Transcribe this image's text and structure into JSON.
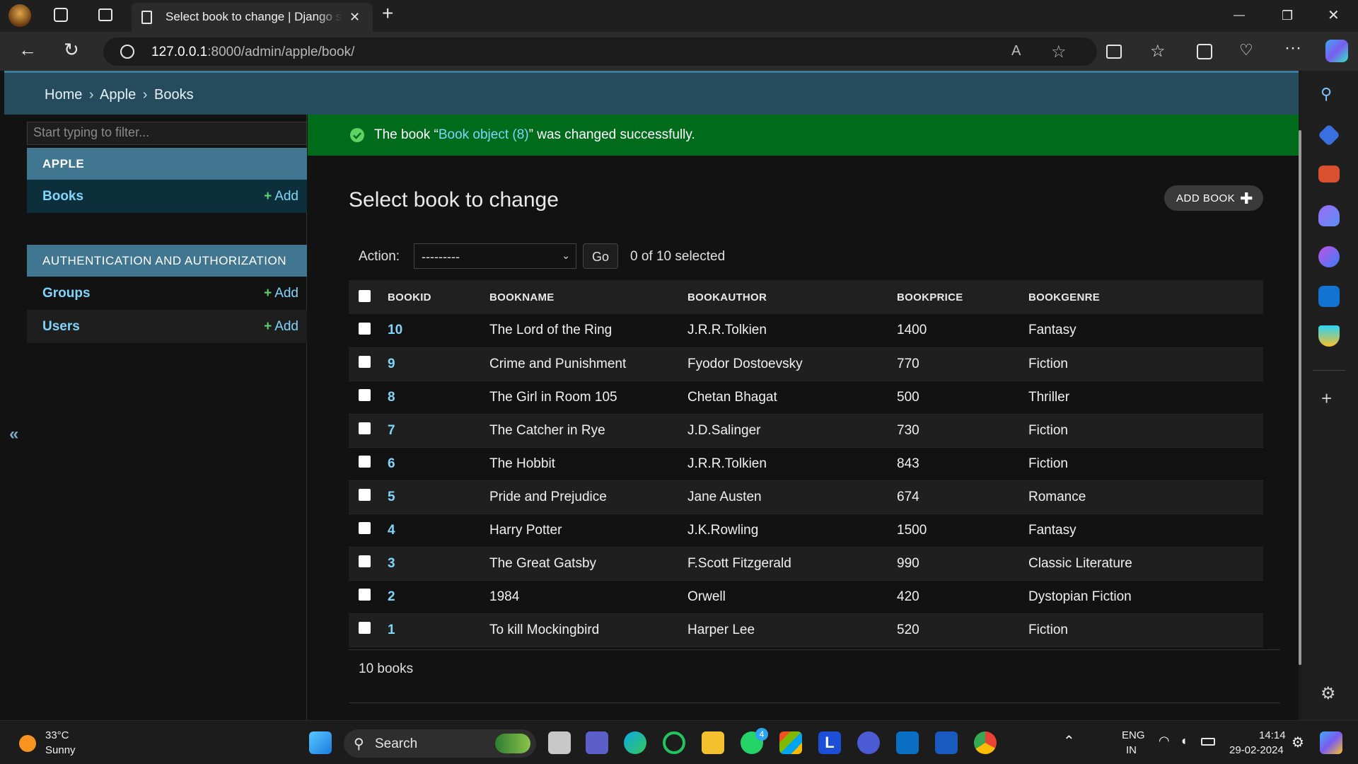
{
  "browser": {
    "tab_title": "Select book to change | Django site admin",
    "url_host": "127.0.0.1",
    "url_path": ":8000/admin/apple/book/",
    "minimize": "—",
    "restore": "❐",
    "close": "✕",
    "new_tab": "+",
    "tab_close": "✕"
  },
  "breadcrumbs": {
    "home": "Home",
    "app": "Apple",
    "current": "Books",
    "sep": "›"
  },
  "sidebar": {
    "filter_placeholder": "Start typing to filter...",
    "apps": [
      {
        "title": "APPLE",
        "models": [
          {
            "name": "Books",
            "add": "Add"
          }
        ]
      },
      {
        "title": "AUTHENTICATION AND AUTHORIZATION",
        "models": [
          {
            "name": "Groups",
            "add": "Add"
          },
          {
            "name": "Users",
            "add": "Add"
          }
        ]
      }
    ],
    "collapse": "«"
  },
  "message": {
    "prefix": "The book “",
    "link": "Book object (8)",
    "suffix": "” was changed successfully."
  },
  "page": {
    "title": "Select book to change",
    "add_button": "ADD BOOK",
    "add_plus": "✚",
    "action_label": "Action:",
    "action_value": "---------",
    "go": "Go",
    "selected": "0 of 10 selected",
    "count": "10 books"
  },
  "table": {
    "columns": [
      "BOOKID",
      "BOOKNAME",
      "BOOKAUTHOR",
      "BOOKPRICE",
      "BOOKGENRE"
    ],
    "rows": [
      [
        "10",
        "The Lord of the Ring",
        "J.R.R.Tolkien",
        "1400",
        "Fantasy"
      ],
      [
        "9",
        "Crime and Punishment",
        "Fyodor Dostoevsky",
        "770",
        "Fiction"
      ],
      [
        "8",
        "The Girl in Room 105",
        "Chetan Bhagat",
        "500",
        "Thriller"
      ],
      [
        "7",
        "The Catcher in Rye",
        "J.D.Salinger",
        "730",
        "Fiction"
      ],
      [
        "6",
        "The Hobbit",
        "J.R.R.Tolkien",
        "843",
        "Fiction"
      ],
      [
        "5",
        "Pride and Prejudice",
        "Jane Austen",
        "674",
        "Romance"
      ],
      [
        "4",
        "Harry Potter",
        "J.K.Rowling",
        "1500",
        "Fantasy"
      ],
      [
        "3",
        "The Great Gatsby",
        "F.Scott Fitzgerald",
        "990",
        "Classic Literature"
      ],
      [
        "2",
        "1984",
        "Orwell",
        "420",
        "Dystopian Fiction"
      ],
      [
        "1",
        "To kill Mockingbird",
        "Harper Lee",
        "520",
        "Fiction"
      ]
    ]
  },
  "taskbar": {
    "weather_temp": "33°C",
    "weather_desc": "Sunny",
    "search": "Search",
    "lang": "ENG",
    "region": "IN",
    "time": "14:14",
    "date": "29-02-2024",
    "teams_badge": "4",
    "l_app": "L"
  },
  "colors": {
    "header": "#264b5d",
    "accent": "#417690",
    "success": "#006b1b",
    "link": "#81d4fa",
    "add_plus": "#5ed16d"
  }
}
